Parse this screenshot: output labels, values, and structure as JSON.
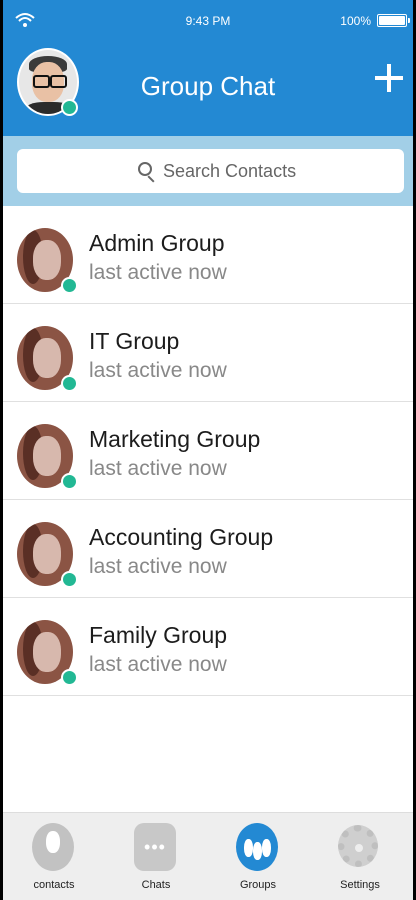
{
  "status": {
    "time": "9:43 PM",
    "battery": "100%"
  },
  "header": {
    "title": "Group Chat"
  },
  "search": {
    "placeholder": "Search Contacts"
  },
  "groups": [
    {
      "name": "Admin Group",
      "status": "last active now"
    },
    {
      "name": "IT Group",
      "status": "last active now"
    },
    {
      "name": "Marketing Group",
      "status": "last active now"
    },
    {
      "name": "Accounting Group",
      "status": "last active now"
    },
    {
      "name": "Family Group",
      "status": "last active now"
    }
  ],
  "tabs": [
    {
      "label": "contacts",
      "icon": "contact-icon"
    },
    {
      "label": "Chats",
      "icon": "chat-icon"
    },
    {
      "label": "Groups",
      "icon": "groups-icon"
    },
    {
      "label": "Settings",
      "icon": "gear-icon"
    }
  ],
  "colors": {
    "primary": "#2389d3",
    "search_bar": "#a2cfe7",
    "online": "#22b894"
  }
}
